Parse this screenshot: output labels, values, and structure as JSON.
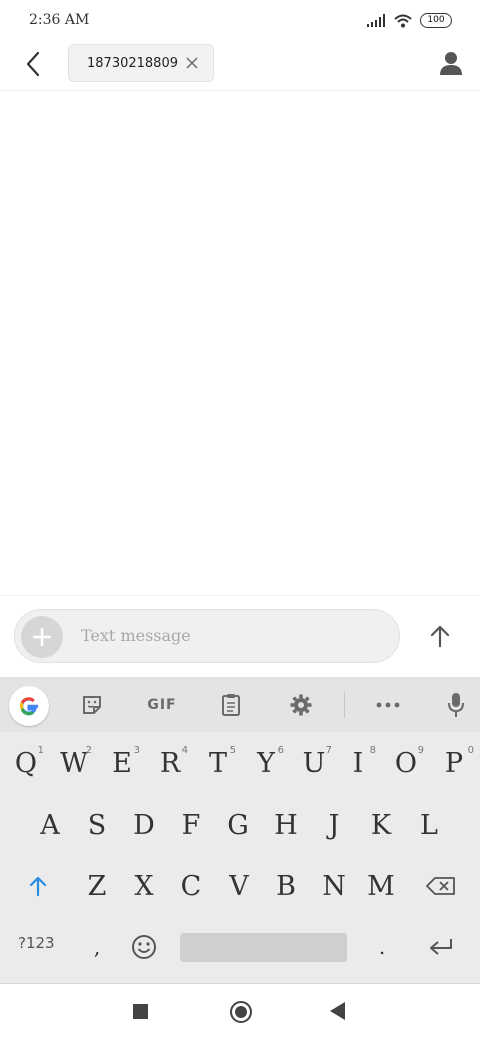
{
  "status_bar": {
    "time": "2:36 AM",
    "battery": "100"
  },
  "header": {
    "recipient": "18730218809"
  },
  "compose": {
    "placeholder": "Text message"
  },
  "keyboard": {
    "toolbar": {
      "gif_label": "GIF"
    },
    "row1": [
      {
        "key": "Q",
        "hint": "1"
      },
      {
        "key": "W",
        "hint": "2"
      },
      {
        "key": "E",
        "hint": "3"
      },
      {
        "key": "R",
        "hint": "4"
      },
      {
        "key": "T",
        "hint": "5"
      },
      {
        "key": "Y",
        "hint": "6"
      },
      {
        "key": "U",
        "hint": "7"
      },
      {
        "key": "I",
        "hint": "8"
      },
      {
        "key": "O",
        "hint": "9"
      },
      {
        "key": "P",
        "hint": "0"
      }
    ],
    "row2": [
      "A",
      "S",
      "D",
      "F",
      "G",
      "H",
      "J",
      "K",
      "L"
    ],
    "row3": [
      "Z",
      "X",
      "C",
      "V",
      "B",
      "N",
      "M"
    ],
    "row4": {
      "symbols": "?123",
      "comma": ",",
      "period": "."
    }
  }
}
